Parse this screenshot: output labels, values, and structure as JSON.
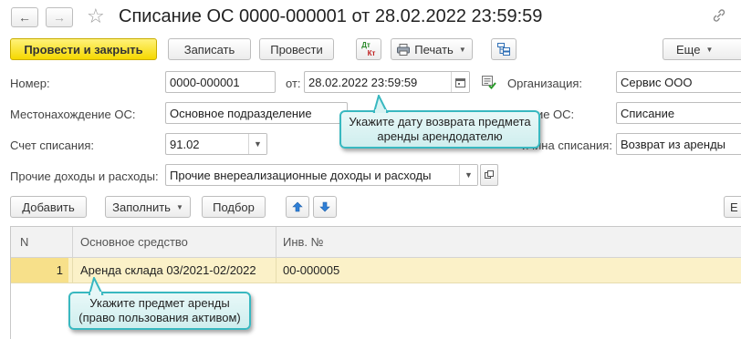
{
  "header": {
    "title": "Списание ОС 0000-000001 от 28.02.2022 23:59:59"
  },
  "toolbar": {
    "post_close_label": "Провести и закрыть",
    "save_label": "Записать",
    "post_label": "Провести",
    "dt_kt_top": "Дт",
    "dt_kt_bottom": "Кт",
    "print_label": "Печать",
    "more_label": "Еще"
  },
  "form": {
    "number_label": "Номер:",
    "number_value": "0000-000001",
    "date_label": "от:",
    "date_value": "28.02.2022 23:59:59",
    "org_label": "Организация:",
    "org_value": "Сервис ООО",
    "location_label": "Местонахождение ОС:",
    "location_value": "Основное подразделение",
    "event_label_visible": "тие ОС:",
    "event_value": "Списание",
    "account_label": "Счет списания:",
    "account_value": "91.02",
    "reason_label_visible": "ичина списания:",
    "reason_value": "Возврат из аренды",
    "other_label": "Прочие доходы и расходы:",
    "other_value": "Прочие внереализационные доходы и расходы"
  },
  "table_toolbar": {
    "add_label": "Добавить",
    "fill_label": "Заполнить",
    "pick_label": "Подбор",
    "cut_label": "Е"
  },
  "table": {
    "columns": [
      "N",
      "Основное средство",
      "Инв. №"
    ],
    "rows": [
      {
        "n": "1",
        "asset": "Аренда склада 03/2021-02/2022",
        "inv": "00-000005"
      }
    ]
  },
  "tooltips": {
    "date_tip_line1": "Укажите дату возврата предмета",
    "date_tip_line2": "аренды арендодателю",
    "asset_tip_line1": "Укажите предмет аренды",
    "asset_tip_line2": "(право пользования активом)"
  },
  "colors": {
    "primary_button": "#f5d800",
    "selected_row": "#fbf1c8",
    "tooltip_border": "#38b8c0",
    "arrow_blue": "#2f7fd6"
  },
  "icons": [
    "back-arrow-icon",
    "forward-arrow-icon",
    "star-icon",
    "link-icon",
    "printer-icon",
    "structure-icon",
    "calendar-icon",
    "checklist-icon",
    "chevron-down-icon",
    "open-icon",
    "arrow-up-icon",
    "arrow-down-icon"
  ]
}
